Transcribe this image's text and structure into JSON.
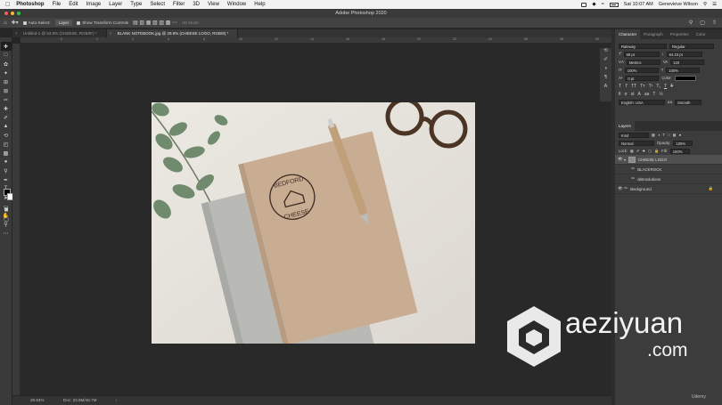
{
  "menubar": {
    "app": "Photoshop",
    "items": [
      "File",
      "Edit",
      "Image",
      "Layer",
      "Type",
      "Select",
      "Filter",
      "3D",
      "View",
      "Window",
      "Help"
    ],
    "clock": "Sat 10:07 AM",
    "user": "Genevieve Wilson"
  },
  "window": {
    "title": "Adobe Photoshop 2020"
  },
  "options": {
    "auto_select_label": "Auto-Select:",
    "auto_select_value": "Layer",
    "transform_label": "Show Transform Controls",
    "mode_3d": "3D Mode:"
  },
  "tabs": [
    {
      "label": "Untitled-1 @ 63.6% (CHEESE, RGB/8*) *"
    },
    {
      "label": "BLANK NOTEBOOK.jpg @ 29.8% (CHEESE LOGO, RGB/8) *"
    }
  ],
  "ruler": [
    "0",
    "2",
    "4",
    "6",
    "8",
    "10",
    "12",
    "14",
    "16",
    "18",
    "20",
    "22",
    "24",
    "26",
    "28",
    "30"
  ],
  "tools": [
    "move",
    "marquee",
    "lasso",
    "magic-wand",
    "crop",
    "frame",
    "eyedropper",
    "healing",
    "brush",
    "stamp",
    "history",
    "eraser",
    "gradient",
    "blur",
    "dodge",
    "pen",
    "type",
    "path-select",
    "shape",
    "hand",
    "zoom"
  ],
  "status": {
    "zoom": "29.84%",
    "doc": "Doc: 23.9M/48.7M"
  },
  "colors": {
    "fg": "#000000",
    "bg": "#ffffff",
    "panel": "#3c3c3c",
    "ui_dark": "#262626"
  },
  "character_panel": {
    "tabs": [
      "Character",
      "Paragraph",
      "Properties",
      "Color"
    ],
    "font": "Raleway",
    "style": "Regular",
    "size": "69 pt",
    "leading": "64.23 pt",
    "kerning": "Metrics",
    "tracking": "120",
    "vscale": "100%",
    "hscale": "100%",
    "baseline": "0 pt",
    "color_label": "Color:",
    "language": "English: USA",
    "antialias": "Smooth"
  },
  "layers_panel": {
    "title": "Layers",
    "filter": "Kind",
    "blend": "Normal",
    "opacity_label": "Opacity:",
    "opacity": "100%",
    "lock_label": "Lock:",
    "fill_label": "Fill:",
    "fill": "100%",
    "layers": [
      {
        "name": "CHEESE LOGO",
        "selected": true,
        "visible": true
      },
      {
        "name": "BLACKROCK",
        "selected": false,
        "visible": false
      },
      {
        "name": "abtesolutions",
        "selected": false,
        "visible": false
      },
      {
        "name": "Background",
        "selected": false,
        "visible": true
      }
    ]
  },
  "logo": {
    "line1": "BEDFORD",
    "line2": "CHEESE"
  },
  "watermark": {
    "text": "aeziyuan",
    "sub": ".com"
  },
  "udemy": "Udemy"
}
